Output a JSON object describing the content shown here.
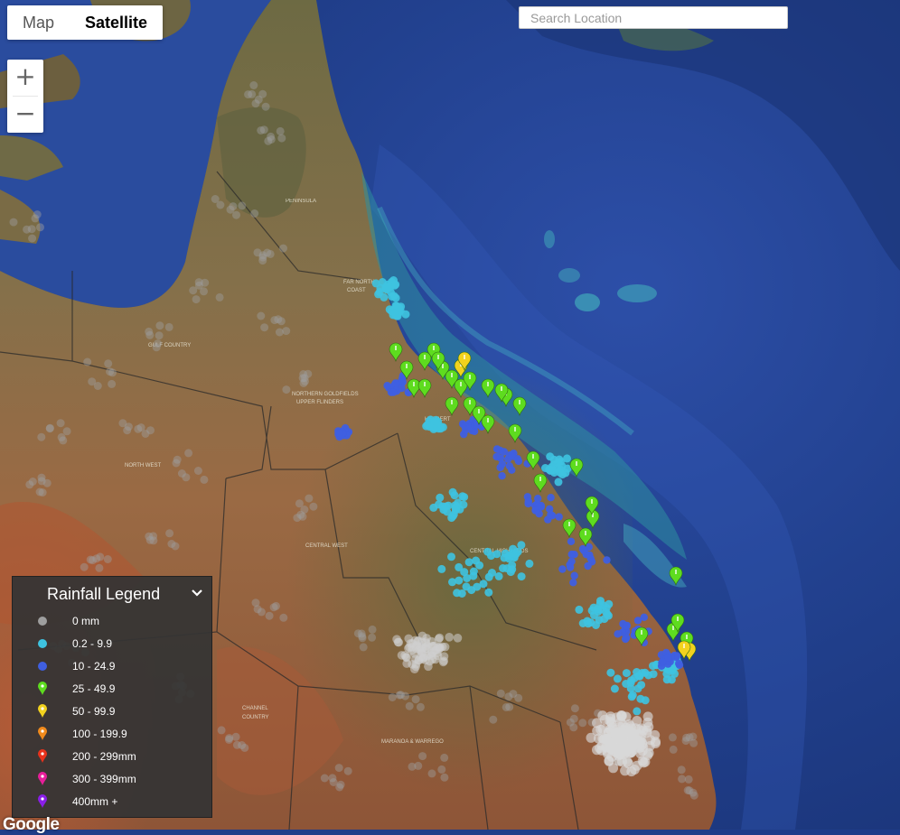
{
  "map_type": {
    "map_label": "Map",
    "satellite_label": "Satellite",
    "selected": "Satellite"
  },
  "search": {
    "placeholder": "Search Location",
    "value": ""
  },
  "zoom": {
    "in_label": "+",
    "out_label": "−"
  },
  "map_labels": {
    "peninsula": "PENINSULA",
    "gulf_country": "GULF COUNTRY",
    "northern_goldfields": "NORTHERN GOLDFIELDS",
    "northern_goldfields_2": "UPPER FLINDERS",
    "north_west": "NORTH WEST",
    "central_west": "CENTRAL WEST",
    "channel_country": "CHANNEL",
    "channel_country_2": "COUNTRY",
    "maranoa": "MARANOA & WARREGO",
    "far_north": "FAR NORTH",
    "far_north_2": "COAST",
    "herbert": "HERBERT",
    "central_highlands": "CENTRAL HIGHLANDS"
  },
  "legend": {
    "title": "Rainfall Legend",
    "items": [
      {
        "label": "0 mm",
        "type": "dot",
        "color": "#9e9e9e"
      },
      {
        "label": "0.2 - 9.9",
        "type": "dot",
        "color": "#3ec3e0"
      },
      {
        "label": "10 - 24.9",
        "type": "dot",
        "color": "#3f5fe0"
      },
      {
        "label": "25 - 49.9",
        "type": "pin",
        "color": "#5edc1f"
      },
      {
        "label": "50 - 99.9",
        "type": "pin",
        "color": "#f2d21e"
      },
      {
        "label": "100 - 199.9",
        "type": "pin",
        "color": "#f08a1c"
      },
      {
        "label": "200 - 299mm",
        "type": "pin",
        "color": "#e8321c"
      },
      {
        "label": "300 - 399mm",
        "type": "pin",
        "color": "#e81e9a"
      },
      {
        "label": "400mm +",
        "type": "pin",
        "color": "#8a1ee8"
      }
    ]
  },
  "attribution": "Google"
}
